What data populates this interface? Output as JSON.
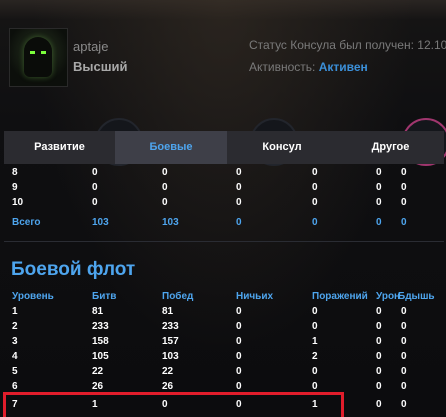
{
  "profile": {
    "username": "aptaje",
    "rank": "Высший",
    "consul_status": "Статус Консула был получен: 12.10",
    "activity_label": "Активность:",
    "activity_value": "Активен"
  },
  "tabs": [
    {
      "label": "Развитие",
      "active": false
    },
    {
      "label": "Боевые",
      "active": true
    },
    {
      "label": "Консул",
      "active": false
    },
    {
      "label": "Другое",
      "active": false
    }
  ],
  "upper_table": {
    "rows": [
      [
        "8",
        "0",
        "0",
        "0",
        "0",
        "0",
        "0"
      ],
      [
        "9",
        "0",
        "0",
        "0",
        "0",
        "0",
        "0"
      ],
      [
        "10",
        "0",
        "0",
        "0",
        "0",
        "0",
        "0"
      ]
    ],
    "total": [
      "Всего",
      "103",
      "103",
      "0",
      "0",
      "0",
      "0"
    ]
  },
  "fleet": {
    "title": "Боевой флот",
    "headers": [
      "Уровень",
      "Битв",
      "Побед",
      "Ничьих",
      "Поражений",
      "Урон",
      "Бдышь"
    ],
    "rows": [
      [
        "1",
        "81",
        "81",
        "0",
        "0",
        "0",
        "0"
      ],
      [
        "2",
        "233",
        "233",
        "0",
        "0",
        "0",
        "0"
      ],
      [
        "3",
        "158",
        "157",
        "0",
        "1",
        "0",
        "0"
      ],
      [
        "4",
        "105",
        "103",
        "0",
        "2",
        "0",
        "0"
      ],
      [
        "5",
        "22",
        "22",
        "0",
        "0",
        "0",
        "0"
      ],
      [
        "6",
        "26",
        "26",
        "0",
        "0",
        "0",
        "0"
      ],
      [
        "7",
        "1",
        "0",
        "0",
        "1",
        "0",
        "0"
      ]
    ]
  },
  "colors": {
    "accent": "#4ea5ee",
    "highlight": "#e11d2b",
    "tab_bg": "#2b2b30",
    "tab_active_bg": "#3e3f48"
  }
}
